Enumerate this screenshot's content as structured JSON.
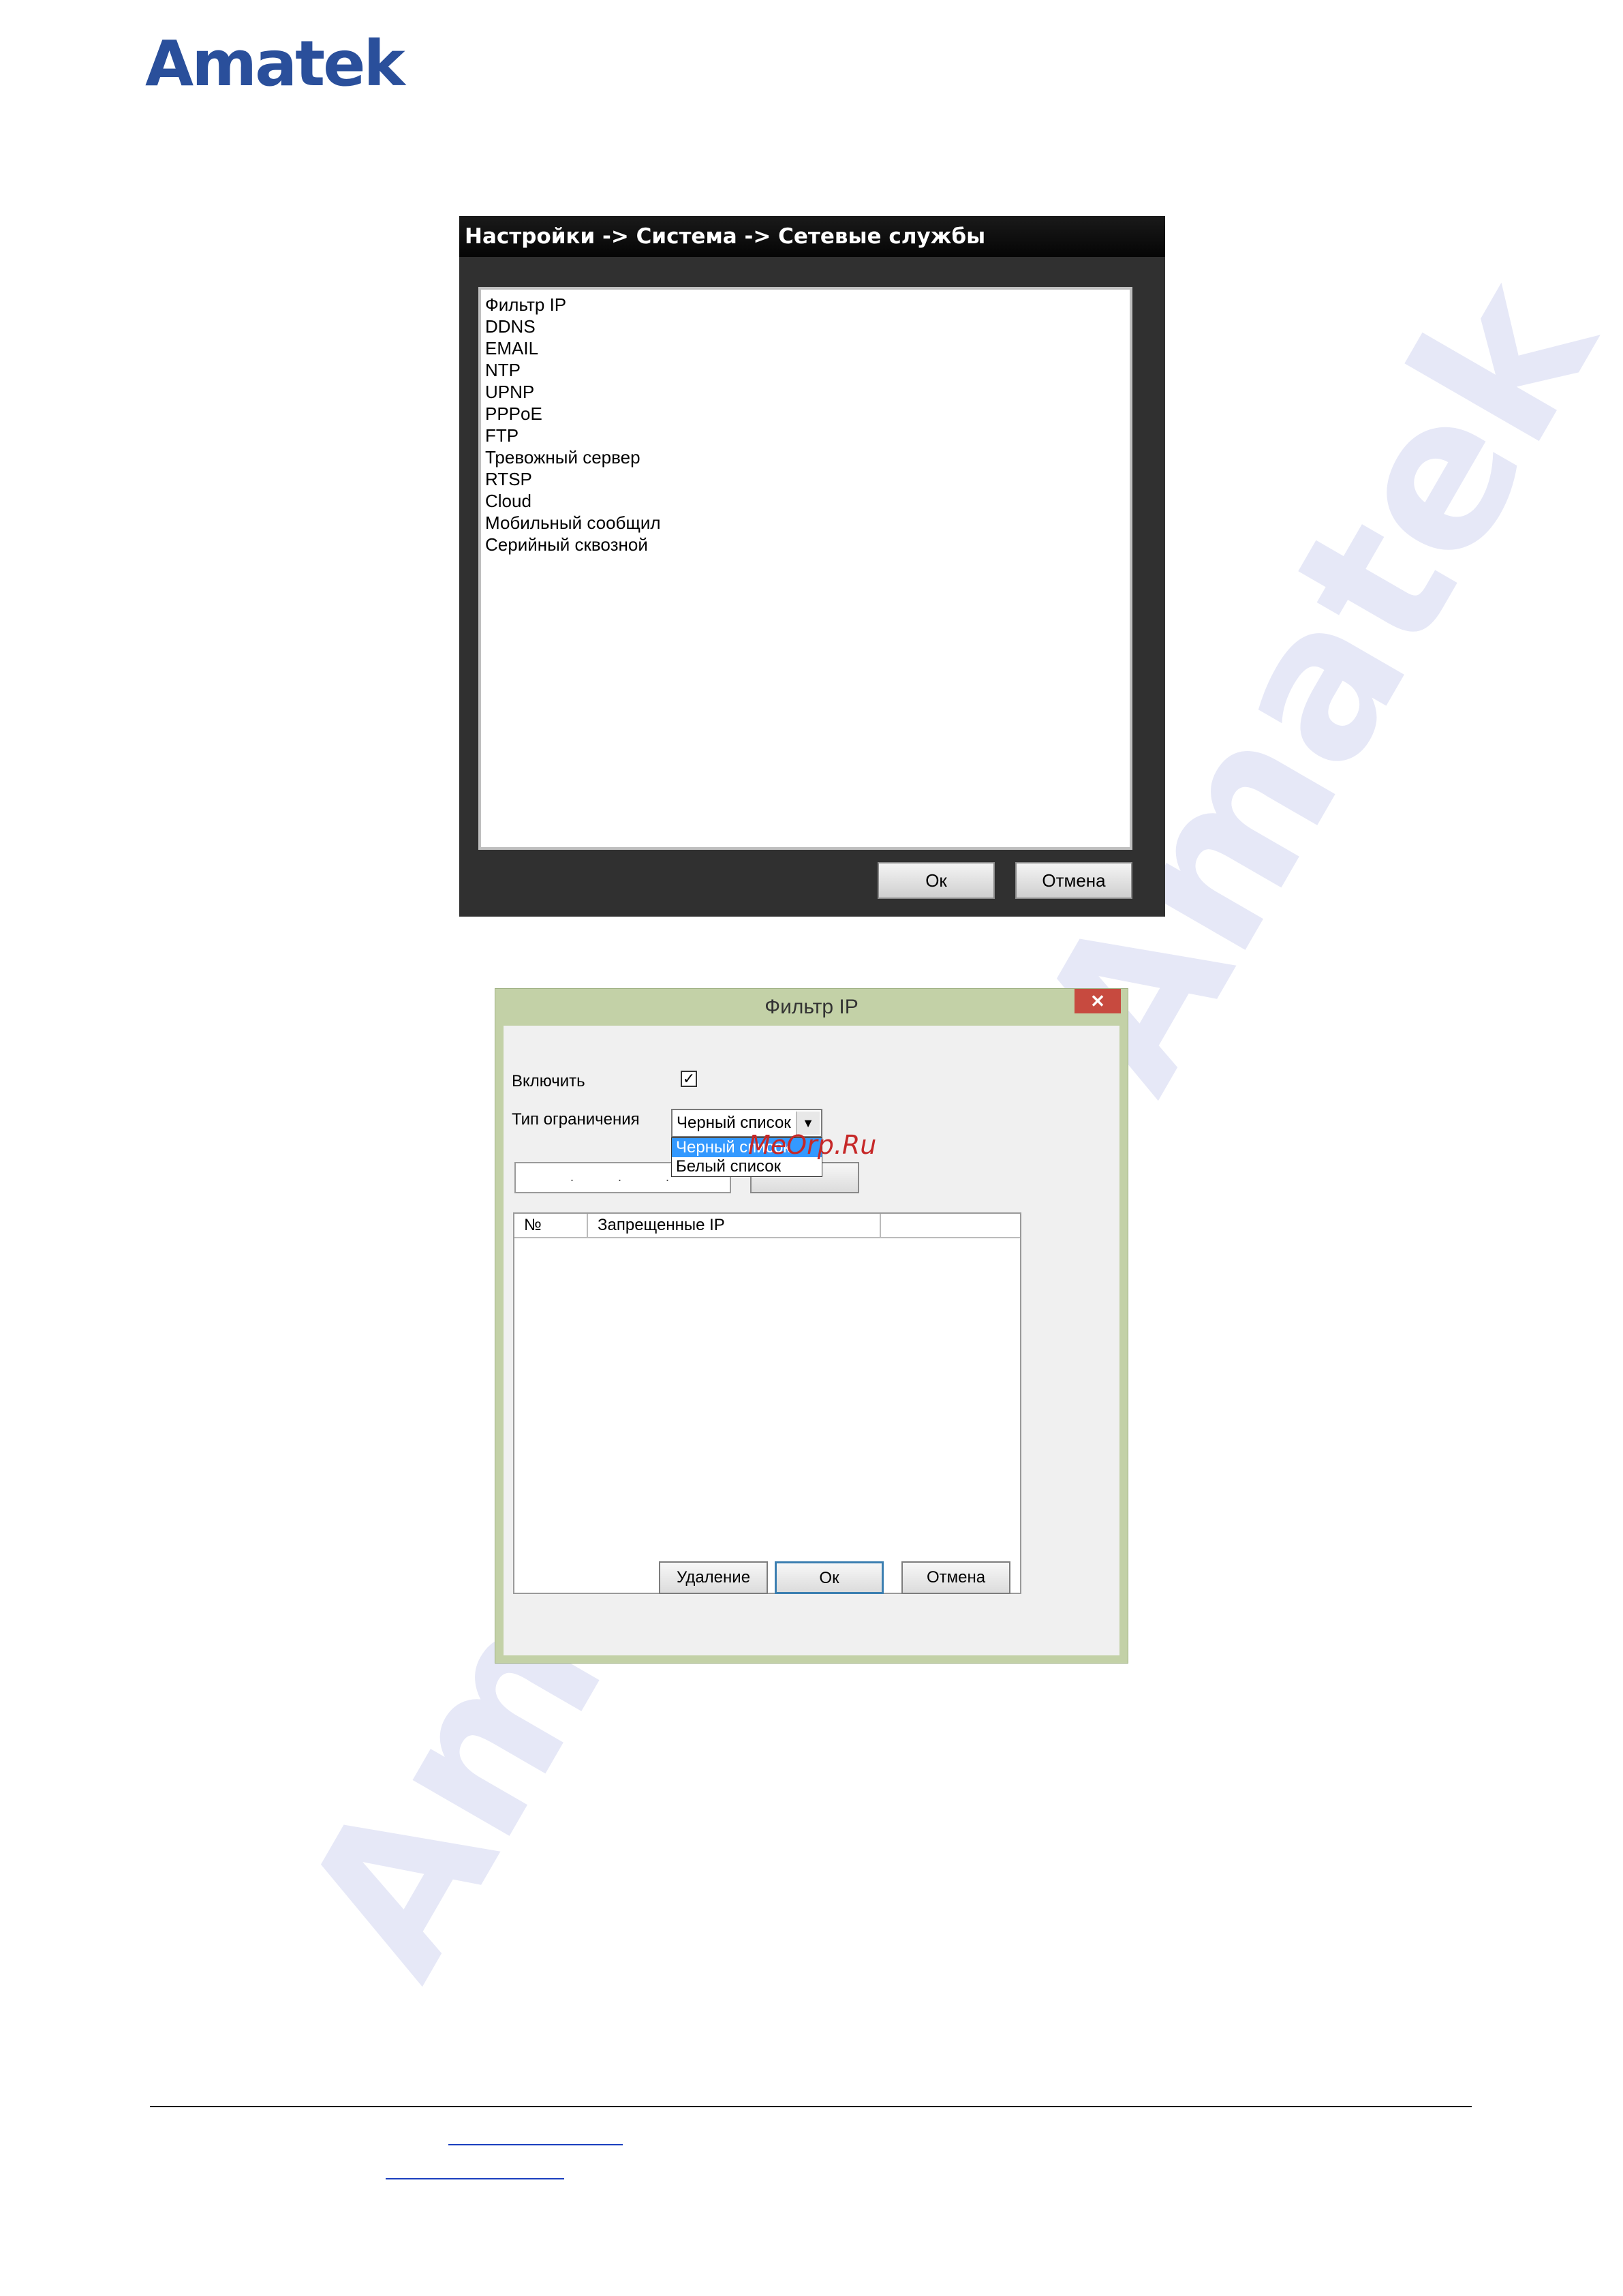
{
  "logo": {
    "text": "Amatek",
    "color": "#2a4f9b"
  },
  "watermarks": [
    "Amatek",
    "Amatek"
  ],
  "dvr": {
    "title": "Настройки -> Система -> Сетевые службы",
    "items": [
      "Фильтр IP",
      "DDNS",
      "EMAIL",
      "NTP",
      "UPNP",
      "PPPoE",
      "FTP",
      "Тревожный сервер",
      "RTSP",
      "Cloud",
      "Мобильный сообщил",
      "Серийный сквозной"
    ],
    "ok_label": "Ок",
    "cancel_label": "Отмена"
  },
  "dialog": {
    "title": "Фильтр IP",
    "close_icon": "close-icon",
    "enable_label": "Включить",
    "enable_checked": true,
    "restriction_label": "Тип ограничения",
    "restriction_value": "Черный список",
    "options": [
      "Черный список",
      "Белый список"
    ],
    "ip_value": ". . .",
    "stamp": "MeOrp.Ru",
    "columns": [
      "№",
      "Запрещенные IP",
      ""
    ],
    "delete_label": "Удаление",
    "ok_label": "Ок",
    "cancel_label": "Отмена",
    "titlebar_color": "#c3d1a7",
    "close_color": "#c74a3f",
    "selection_color": "#3399ff"
  }
}
